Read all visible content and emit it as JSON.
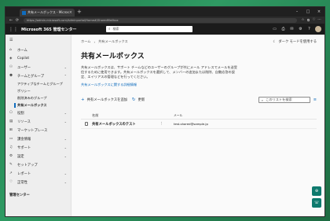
{
  "browser": {
    "tab_title": "共有メールボックス - Microsoft 365 管",
    "tab_close": "×",
    "new_tab": "+",
    "window_controls": [
      "–",
      "□",
      "×"
    ],
    "url": "https://admin.microsoft.com/Adminportal/Home#/SharedMailbox",
    "nav": [
      "←",
      "⟳"
    ],
    "right_icons": [
      "☆",
      "⧉",
      "♡",
      "⋯"
    ]
  },
  "header": {
    "waffle": "⋮⋮",
    "app_title": "Microsoft 365 管理センター",
    "search_icon": "⌕",
    "search_placeholder": "検索",
    "icons": [
      "▭",
      "⎙",
      "✉",
      "⚙",
      "?"
    ]
  },
  "sidebar": {
    "toggle": "☰",
    "items": [
      {
        "icon": "⌂",
        "label": "ホーム",
        "chevron": ""
      },
      {
        "icon": "◈",
        "label": "Copilot",
        "chevron": ""
      },
      {
        "icon": "⚇",
        "label": "ユーザー",
        "chevron": "⌄"
      },
      {
        "icon": "⚉",
        "label": "チームとグループ",
        "chevron": "⌃"
      }
    ],
    "sub_items": [
      {
        "label": "アクティブなチームとグループ",
        "active": false
      },
      {
        "label": "ポリシー",
        "active": false
      },
      {
        "label": "削除済みのグループ",
        "active": false
      },
      {
        "label": "共有メールボックス",
        "active": true
      }
    ],
    "items2": [
      {
        "icon": "⎔",
        "label": "役割",
        "chevron": "⌄"
      },
      {
        "icon": "▤",
        "label": "リソース",
        "chevron": "⌄"
      },
      {
        "icon": "⊞",
        "label": "マーケットプレース",
        "chevron": ""
      },
      {
        "icon": "▭",
        "label": "課金情報",
        "chevron": "⌄"
      },
      {
        "icon": "♫",
        "label": "サポート",
        "chevron": "⌄"
      },
      {
        "icon": "⚙",
        "label": "設定",
        "chevron": "⌄"
      },
      {
        "icon": "✎",
        "label": "セットアップ",
        "chevron": ""
      },
      {
        "icon": "↗",
        "label": "レポート",
        "chevron": "⌄"
      },
      {
        "icon": "♡",
        "label": "正常性",
        "chevron": "⌄"
      }
    ],
    "section": "管理センター"
  },
  "content": {
    "breadcrumb": [
      "ホーム",
      "共有メールボックス"
    ],
    "breadcrumb_sep": "›",
    "dark_mode_icon": "☾",
    "dark_mode_label": "ダーク モードを使用する",
    "title": "共有メールボックス",
    "description": "共有メールボックスは、サポート チームなどのユーザーのグループが共にメール アドレスでメールを送受信するために使用できます。共有メールボックスを選択して、メンバーの追加または削除、自動応答の設定、エイリアスの管理などを行ってください。",
    "learn_more": "共有メールボックスに関する詳細情報",
    "toolbar": {
      "add_icon": "+",
      "add_label": "共有メールボックスを追加",
      "refresh_icon": "↻",
      "refresh_label": "更新",
      "search_icon": "⌕",
      "search_placeholder": "このリストを検索",
      "filter_icon": "≡"
    },
    "table": {
      "columns": [
        "名前",
        "メール"
      ],
      "rows": [
        {
          "name": "共有メールボックスのテスト",
          "more": "⋮",
          "email": "test-shared@sample.jp"
        }
      ]
    }
  },
  "fab": [
    "⊕",
    "☏"
  ],
  "colors": {
    "accent": "#0f6cbd",
    "header_bg": "#1b1b1b",
    "fab": "#0e7a6e"
  }
}
